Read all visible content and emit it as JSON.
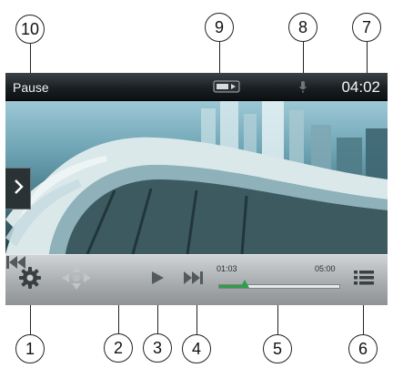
{
  "callouts": {
    "c1": "1",
    "c2": "2",
    "c3": "3",
    "c4": "4",
    "c5": "5",
    "c6": "6",
    "c7": "7",
    "c8": "8",
    "c9": "9",
    "c10": "10"
  },
  "status_bar": {
    "state": "Pause",
    "clock": "04:02",
    "center_icon": "media-source-icon",
    "mic_icon": "microphone-icon"
  },
  "side_tab": {
    "icon": "chevron-right-icon"
  },
  "controls": {
    "settings_icon": "gear-icon",
    "dpad_icon": "dpad-icon",
    "prev_icon": "skip-previous-icon",
    "play_icon": "play-icon",
    "next_icon": "skip-next-icon",
    "list_icon": "list-icon"
  },
  "progress": {
    "elapsed": "01:03",
    "total": "05:00",
    "fraction": 0.21
  },
  "colors": {
    "progress_accent": "#2e9e4a",
    "status_bar": "#1a1f22",
    "control_bar": "#a5a9ab"
  }
}
